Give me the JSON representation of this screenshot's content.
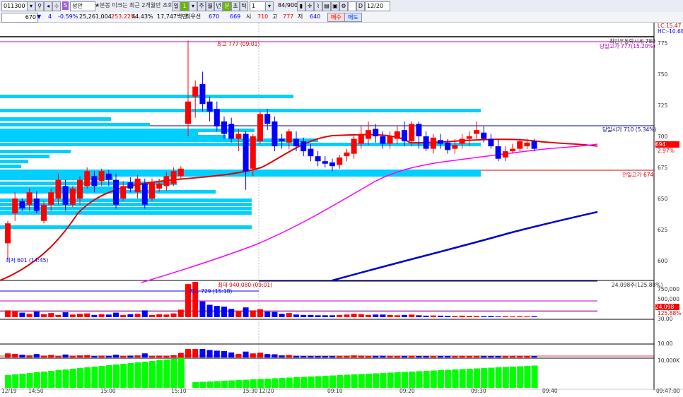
{
  "toolbar": {
    "code": "011300",
    "name_badge": "S",
    "name": "성안",
    "notice": "★분봉 미크는 최근 2개월만 조회",
    "periods": [
      "일",
      "1",
      "주",
      "월",
      "년",
      "분",
      "초",
      "틱"
    ],
    "interval": "1",
    "count": "84/900",
    "date": "12/20"
  },
  "quote": {
    "price": "670",
    "change": "4",
    "change_pct": "-0.59%",
    "volume": "25,261,004",
    "vol_ratio": "253.22%",
    "turnover_ratio": "44.43%",
    "amount": "17,747백만",
    "best_label": "최우선",
    "ask": "670",
    "bid": "669",
    "open_label": "시",
    "open": "710",
    "high_label": "고",
    "high": "777",
    "low_label": "저",
    "low": "640",
    "buy_label": "매수",
    "sell_label": "매도"
  },
  "price_axis": {
    "ticks": [
      "775",
      "750",
      "725",
      "700",
      "675",
      "650",
      "625",
      "600"
    ],
    "lc": "LC:15.47",
    "hc": "HC:-10.68",
    "current": "694",
    "current_pct": "2.97%"
  },
  "annotations": {
    "high": "최고 777 (09:01)",
    "low": "최저 601 (14:45)",
    "upper_limit": "최빈우동락시세 780",
    "day_high": "당일고가 777(15.20%)",
    "day_open": "당일시가 710 (5.34%)",
    "prev_high": "전일고가 674",
    "vol_max": "최대 940,080 (09:01)",
    "vol_min": "최소 729 (15:18)",
    "vol_now": "24,098주(125.88%)"
  },
  "volume_axis": {
    "ticks": [
      "750,000",
      "500,000",
      "250,000"
    ],
    "current": "24,098",
    "current_pct": "125.88%"
  },
  "ind_axis": {
    "ticks": [
      "30.00",
      "10.00"
    ]
  },
  "obv_axis": {
    "ticks": [
      "10,000K"
    ]
  },
  "time_axis": {
    "labels": [
      "12/19",
      "14:50",
      "15:00",
      "15:10",
      "15:30",
      "12/20",
      "09:10",
      "09:20",
      "09:30",
      "09:40"
    ],
    "right": "09:47:00"
  },
  "colors": {
    "up": "#ff0000",
    "down": "#0000ff",
    "profile": "#00cfff",
    "ma_red": "#e00000",
    "ma_pink": "#ff00ff",
    "ma_blue": "#0000cc",
    "obv": "#00ff00"
  },
  "chart_data": {
    "type": "candlestick",
    "candles": [
      [
        614,
        630,
        632,
        601
      ],
      [
        638,
        650,
        655,
        632
      ],
      [
        648,
        642,
        650,
        640
      ],
      [
        645,
        655,
        658,
        640
      ],
      [
        650,
        640,
        656,
        638
      ],
      [
        632,
        645,
        648,
        630
      ],
      [
        645,
        655,
        658,
        640
      ],
      [
        650,
        665,
        670,
        645
      ],
      [
        660,
        645,
        665,
        640
      ],
      [
        645,
        658,
        660,
        643
      ],
      [
        650,
        665,
        668,
        645
      ],
      [
        660,
        672,
        675,
        658
      ],
      [
        668,
        660,
        672,
        655
      ],
      [
        664,
        672,
        674,
        660
      ],
      [
        670,
        665,
        673,
        660
      ],
      [
        665,
        645,
        670,
        642
      ],
      [
        650,
        660,
        664,
        648
      ],
      [
        663,
        658,
        667,
        655
      ],
      [
        655,
        666,
        669,
        650
      ],
      [
        662,
        645,
        666,
        642
      ],
      [
        650,
        663,
        666,
        648
      ],
      [
        658,
        662,
        666,
        655
      ],
      [
        660,
        668,
        671,
        656
      ],
      [
        662,
        672,
        675,
        660
      ],
      [
        668,
        674,
        676,
        666
      ],
      [
        710,
        728,
        777,
        700
      ],
      [
        732,
        740,
        745,
        715
      ],
      [
        742,
        726,
        752,
        720
      ],
      [
        728,
        720,
        732,
        712
      ],
      [
        722,
        708,
        728,
        704
      ],
      [
        712,
        702,
        716,
        698
      ],
      [
        710,
        698,
        715,
        695
      ],
      [
        698,
        702,
        706,
        688
      ],
      [
        702,
        672,
        704,
        657
      ],
      [
        674,
        700,
        702,
        668
      ],
      [
        696,
        718,
        720,
        694
      ],
      [
        718,
        710,
        722,
        705
      ],
      [
        712,
        692,
        716,
        688
      ],
      [
        698,
        696,
        702,
        690
      ],
      [
        695,
        704,
        706,
        690
      ],
      [
        698,
        692,
        704,
        688
      ],
      [
        696,
        688,
        699,
        684
      ],
      [
        690,
        684,
        694,
        680
      ],
      [
        684,
        680,
        688,
        676
      ],
      [
        680,
        678,
        684,
        675
      ],
      [
        679,
        676,
        682,
        672
      ],
      [
        677,
        683,
        685,
        674
      ],
      [
        684,
        687,
        690,
        680
      ],
      [
        686,
        698,
        702,
        682
      ],
      [
        694,
        702,
        708,
        690
      ],
      [
        698,
        705,
        712,
        693
      ],
      [
        706,
        700,
        710,
        695
      ],
      [
        700,
        694,
        704,
        690
      ],
      [
        694,
        700,
        704,
        690
      ],
      [
        698,
        704,
        708,
        694
      ],
      [
        705,
        696,
        712,
        692
      ],
      [
        696,
        710,
        712,
        692
      ],
      [
        710,
        700,
        712,
        690
      ],
      [
        700,
        690,
        704,
        688
      ],
      [
        690,
        699,
        702,
        686
      ],
      [
        697,
        694,
        702,
        690
      ],
      [
        695,
        689,
        698,
        686
      ],
      [
        690,
        693,
        698,
        686
      ],
      [
        694,
        698,
        702,
        690
      ],
      [
        698,
        700,
        704,
        692
      ],
      [
        702,
        705,
        712,
        698
      ],
      [
        703,
        698,
        708,
        695
      ],
      [
        698,
        692,
        702,
        690
      ],
      [
        692,
        682,
        698,
        680
      ],
      [
        683,
        688,
        692,
        680
      ],
      [
        688,
        690,
        694,
        686
      ],
      [
        690,
        696,
        698,
        688
      ],
      [
        692,
        695,
        698,
        690
      ],
      [
        696,
        690,
        698,
        688
      ]
    ],
    "volume": [
      180000,
      160000,
      120000,
      90000,
      150000,
      80000,
      110000,
      60000,
      130000,
      70000,
      90000,
      100000,
      60000,
      80000,
      70000,
      120000,
      60000,
      80000,
      90000,
      180000,
      60000,
      80000,
      70000,
      100000,
      200000,
      880000,
      940080,
      420000,
      330000,
      300000,
      280000,
      220000,
      160000,
      260000,
      180000,
      210000,
      150000,
      140000,
      90000,
      110000,
      70000,
      60000,
      60000,
      50000,
      50000,
      50000,
      60000,
      70000,
      90000,
      80000,
      60000,
      70000,
      70000,
      60000,
      50000,
      60000,
      70000,
      50000,
      40000,
      45000,
      40000,
      35000,
      30000,
      40000,
      35000,
      30000,
      25000,
      30000,
      20000,
      25000,
      20000,
      24000,
      22000,
      24098
    ]
  }
}
